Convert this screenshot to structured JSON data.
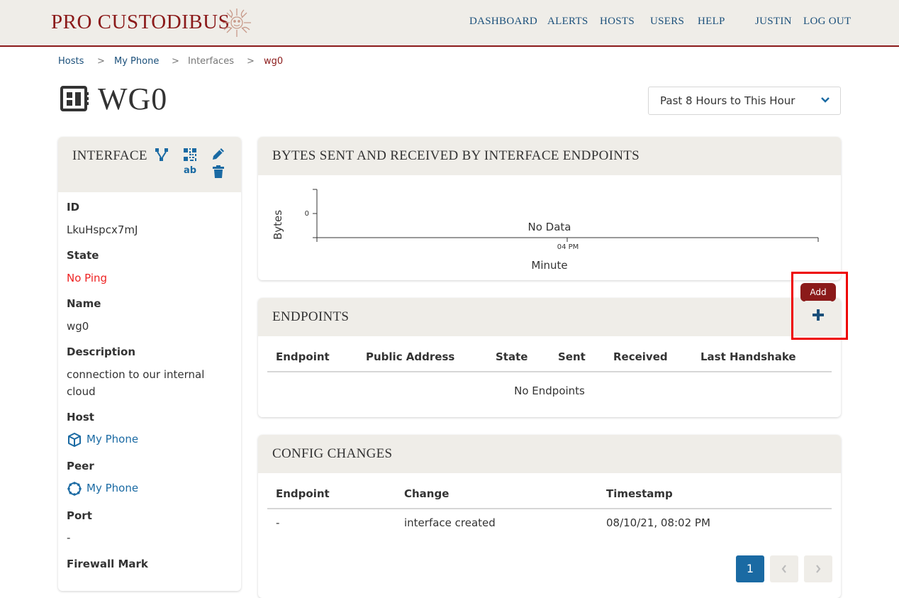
{
  "brand": {
    "name": "PRO CUSTODIBUS"
  },
  "nav": {
    "dashboard": "DASHBOARD",
    "alerts": "ALERTS",
    "hosts": "HOSTS",
    "users": "USERS",
    "help": "HELP",
    "user": "JUSTIN",
    "logout": "LOG OUT"
  },
  "breadcrumb": {
    "hosts": "Hosts",
    "host": "My Phone",
    "interfaces": "Interfaces",
    "current": "wg0",
    "sep": ">"
  },
  "page": {
    "title": "WG0"
  },
  "time_range": {
    "selected": "Past 8 Hours to This Hour"
  },
  "interface": {
    "title": "INTERFACE",
    "qr_code_label": "ab",
    "fields": {
      "id_label": "ID",
      "id_value": "LkuHspcx7mJ",
      "state_label": "State",
      "state_value": "No Ping",
      "name_label": "Name",
      "name_value": "wg0",
      "desc_label": "Description",
      "desc_value": "connection to our internal cloud",
      "host_label": "Host",
      "host_value": "My Phone",
      "peer_label": "Peer",
      "peer_value": "My Phone",
      "port_label": "Port",
      "port_value": "-",
      "fwmark_label": "Firewall Mark"
    }
  },
  "chart": {
    "title": "BYTES SENT AND RECEIVED BY INTERFACE ENDPOINTS",
    "no_data": "No Data"
  },
  "chart_data": {
    "type": "line",
    "title": "BYTES SENT AND RECEIVED BY INTERFACE ENDPOINTS",
    "xlabel": "Minute",
    "ylabel": "Bytes",
    "x_ticks": [
      "04 PM"
    ],
    "y_ticks": [
      "0"
    ],
    "series": []
  },
  "endpoints": {
    "title": "ENDPOINTS",
    "columns": [
      "Endpoint",
      "Public Address",
      "State",
      "Sent",
      "Received",
      "Last Handshake"
    ],
    "empty": "No Endpoints",
    "add_tooltip": "Add"
  },
  "config_changes": {
    "title": "CONFIG CHANGES",
    "columns": [
      "Endpoint",
      "Change",
      "Timestamp"
    ],
    "rows": [
      {
        "endpoint": "-",
        "change": "interface created",
        "timestamp": "08/10/21, 08:02 PM"
      }
    ]
  },
  "pagination": {
    "current": "1"
  },
  "colors": {
    "brand": "#8b1a1a",
    "link": "#1a4f7a",
    "header_bg": "#efede8",
    "alert_red": "#e22",
    "page_active": "#1a6aa3"
  }
}
